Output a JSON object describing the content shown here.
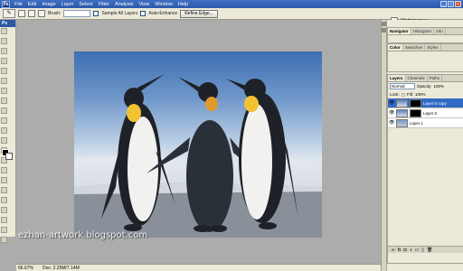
{
  "app": {
    "logo": "Ps"
  },
  "menu": [
    "File",
    "Edit",
    "Image",
    "Layer",
    "Select",
    "Filter",
    "Analysis",
    "View",
    "Window",
    "Help"
  ],
  "window_controls": [
    "_",
    "□",
    "×"
  ],
  "options": {
    "brush_label": "Brush:",
    "brush_value": "",
    "sample_all_layers": "Sample All Layers",
    "auto_enhance": "Auto-Enhance",
    "refine_edge": "Refine Edge...",
    "workspace": "Workspace ▾"
  },
  "panels": {
    "navigator_tabs": [
      "Navigator",
      "Histogram",
      "Info"
    ],
    "color_tabs": [
      "Color",
      "Swatches",
      "Styles"
    ],
    "layers_tabs": [
      "Layers",
      "Channels",
      "Paths"
    ],
    "blend_mode": "Normal",
    "opacity_label": "Opacity:",
    "opacity_value": "100%",
    "lock_label": "Lock:",
    "fill_label": "Fill:",
    "fill_value": "100%",
    "layers": [
      {
        "name": "Layer 0 copy",
        "selected": true,
        "has_mask": false
      },
      {
        "name": "Layer 0",
        "selected": false,
        "has_mask": true
      },
      {
        "name": "Layer 1",
        "selected": false,
        "has_mask": false
      }
    ]
  },
  "status": {
    "zoom": "66.67%",
    "doc": "Doc: 2.25M/7.14M"
  },
  "watermark": "ezhan-artwork.blogspot.com",
  "colors": {
    "title_bar": "#2d58a8",
    "panel_bg": "#ece9d8",
    "selected_layer": "#316ac5",
    "canvas_bg": "#acacac"
  }
}
